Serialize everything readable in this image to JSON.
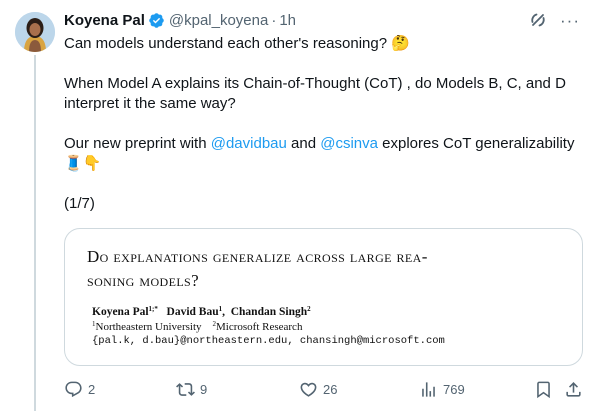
{
  "author": {
    "name": "Koyena Pal",
    "handle": "@kpal_koyena",
    "separator": "·",
    "time": "1h"
  },
  "tweet": {
    "line1": "Can models understand each other's reasoning? 🤔",
    "line2": "When Model A explains its Chain-of-Thought (CoT) , do Models B, C, and D interpret it the same way?",
    "line3_prefix": "Our new preprint with ",
    "mention1": "@davidbau",
    "line3_mid": " and ",
    "mention2": "@csinva",
    "line3_suffix": " explores CoT generalizability 🧵👇",
    "counter": "(1/7)"
  },
  "paper_card": {
    "title_line1": "Do explanations generalize across large rea-",
    "title_line2": "soning models?",
    "author1": "Koyena Pal",
    "author1_sup": "1;*",
    "author2": "David Bau",
    "author2_sup": "1",
    "author3": "Chandan Singh",
    "author3_sup": "2",
    "affil1_sup": "1",
    "affil1": "Northeastern University",
    "affil2_sup": "2",
    "affil2": "Microsoft Research",
    "emails": "{pal.k, d.bau}@northeastern.edu, chansingh@microsoft.com"
  },
  "actions": {
    "replies": "2",
    "retweets": "9",
    "likes": "26",
    "views": "769"
  },
  "colors": {
    "accent": "#1d9bf0",
    "muted": "#536471",
    "border": "#cfd9de"
  },
  "icons": [
    "verified-badge-icon",
    "grok-icon",
    "more-icon",
    "reply-icon",
    "retweet-icon",
    "like-icon",
    "views-icon",
    "bookmark-icon",
    "share-icon"
  ]
}
